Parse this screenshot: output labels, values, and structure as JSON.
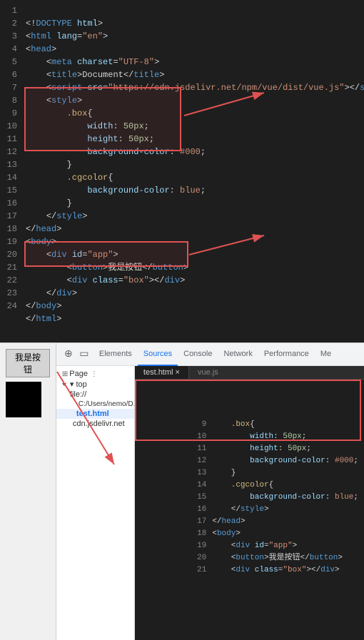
{
  "editor": {
    "lines": [
      {
        "num": 1,
        "html": "&lt;!DOCTYPE html&gt;"
      },
      {
        "num": 2,
        "html": "&lt;html lang=&quot;en&quot;&gt;"
      },
      {
        "num": 3,
        "html": "&lt;head&gt;"
      },
      {
        "num": 4,
        "html": "    &lt;meta charset=&quot;UTF-8&quot;&gt;"
      },
      {
        "num": 5,
        "html": "    &lt;title&gt;Document&lt;/title&gt;"
      },
      {
        "num": 6,
        "html": "    &lt;script src=&quot;https://cdn.jsdelivr.net/npm/vue/dist/vue.js&quot;&gt;&lt;/script&gt;"
      },
      {
        "num": 7,
        "html": "    &lt;style&gt;"
      },
      {
        "num": 8,
        "html": "        .box{"
      },
      {
        "num": 9,
        "html": "            width: 50px;"
      },
      {
        "num": 10,
        "html": "            height: 50px;"
      },
      {
        "num": 11,
        "html": "            background-color: #000;"
      },
      {
        "num": 12,
        "html": "        }"
      },
      {
        "num": 13,
        "html": "        .cgcolor{"
      },
      {
        "num": 14,
        "html": "            background-color: blue;"
      },
      {
        "num": 15,
        "html": "        }"
      },
      {
        "num": 16,
        "html": "    &lt;/style&gt;"
      },
      {
        "num": 17,
        "html": "&lt;/head&gt;"
      },
      {
        "num": 18,
        "html": "&lt;body&gt;"
      },
      {
        "num": 19,
        "html": "    &lt;div id=&quot;app&quot;&gt;"
      },
      {
        "num": 20,
        "html": "        &lt;button&gt;我是按钮&lt;/button&gt;"
      },
      {
        "num": 21,
        "html": "        &lt;div class=&quot;box&quot;&gt;&lt;/div&gt;"
      },
      {
        "num": 22,
        "html": "    &lt;/div&gt;"
      },
      {
        "num": 23,
        "html": "&lt;/body&gt;"
      },
      {
        "num": 24,
        "html": "&lt;/html&gt;"
      }
    ]
  },
  "preview": {
    "button_label": "我是按钮"
  },
  "devtools": {
    "tabs": [
      "Elements",
      "Sources",
      "Console",
      "Network",
      "Performance",
      "Me"
    ],
    "active_tab": "Sources",
    "file_tabs": [
      "test.html",
      "vue.js"
    ],
    "active_file": "test.html",
    "sidebar": {
      "top_label": "top",
      "items": [
        {
          "label": "file://",
          "type": "folder"
        },
        {
          "label": "C:/Users/nemo/D...",
          "type": "folder"
        },
        {
          "label": "test.html",
          "type": "file",
          "selected": true
        },
        {
          "label": "cdn.jsdelivr.net",
          "type": "folder"
        }
      ]
    },
    "code_lines": [
      {
        "num": 9,
        "html": "        .box{"
      },
      {
        "num": 10,
        "html": "            width: 50px;"
      },
      {
        "num": 11,
        "html": "            height: 50px;"
      },
      {
        "num": 12,
        "html": "            background-color: #000;"
      },
      {
        "num": 13,
        "html": "        }"
      },
      {
        "num": 14,
        "html": "        .cgcolor{"
      },
      {
        "num": 15,
        "html": "            background-color: blue;"
      },
      {
        "num": 16,
        "html": "        &lt;/style&gt;"
      },
      {
        "num": 17,
        "html": "    &lt;/head&gt;"
      },
      {
        "num": 18,
        "html": "    &lt;body&gt;"
      },
      {
        "num": 19,
        "html": "        &lt;div id=&quot;app&quot;&gt;"
      },
      {
        "num": 20,
        "html": "        &lt;button&gt;我是按钮&lt;/button&gt;"
      },
      {
        "num": 21,
        "html": "        &lt;div class=&quot;box&quot;&gt;&lt;/div&gt;"
      }
    ]
  }
}
